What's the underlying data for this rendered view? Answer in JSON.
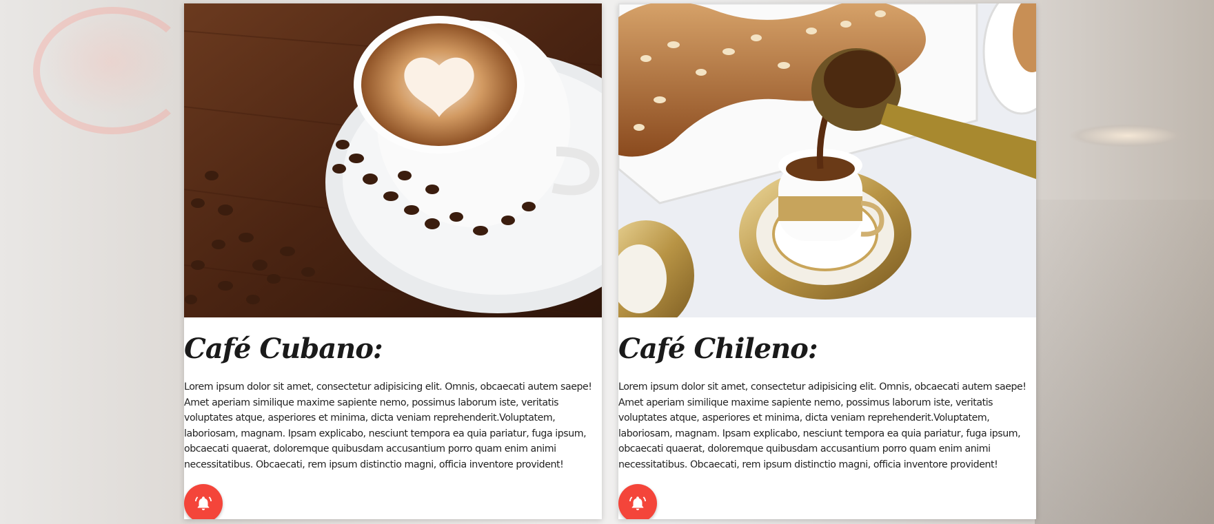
{
  "cards": [
    {
      "title": "Café Cubano:",
      "body": "Lorem ipsum dolor sit amet, consectetur adipisicing elit. Omnis, obcaecati autem saepe! Amet aperiam similique maxime sapiente nemo, possimus laborum iste, veritatis voluptates atque, asperiores et minima, dicta veniam reprehenderit.Voluptatem, laboriosam, magnam. Ipsam explicabo, nesciunt tempora ea quia pariatur, fuga ipsum, obcaecati quaerat, doloremque quibusdam accusantium porro quam enim animi necessitatibus. Obcaecati, rem ipsum distinctio magni, officia inventore provident!",
      "icon": "bell-alert-icon"
    },
    {
      "title": "Café Chileno:",
      "body": "Lorem ipsum dolor sit amet, consectetur adipisicing elit. Omnis, obcaecati autem saepe! Amet aperiam similique maxime sapiente nemo, possimus laborum iste, veritatis voluptates atque, asperiores et minima, dicta veniam reprehenderit.Voluptatem, laboriosam, magnam. Ipsam explicabo, nesciunt tempora ea quia pariatur, fuga ipsum, obcaecati quaerat, doloremque quibusdam accusantium porro quam enim animi necessitatibus. Obcaecati, rem ipsum distinctio magni, officia inventore provident!",
      "icon": "bell-alert-icon"
    }
  ],
  "colors": {
    "accent": "#f4453a",
    "card_background": "#ffffff",
    "text": "#222222"
  }
}
